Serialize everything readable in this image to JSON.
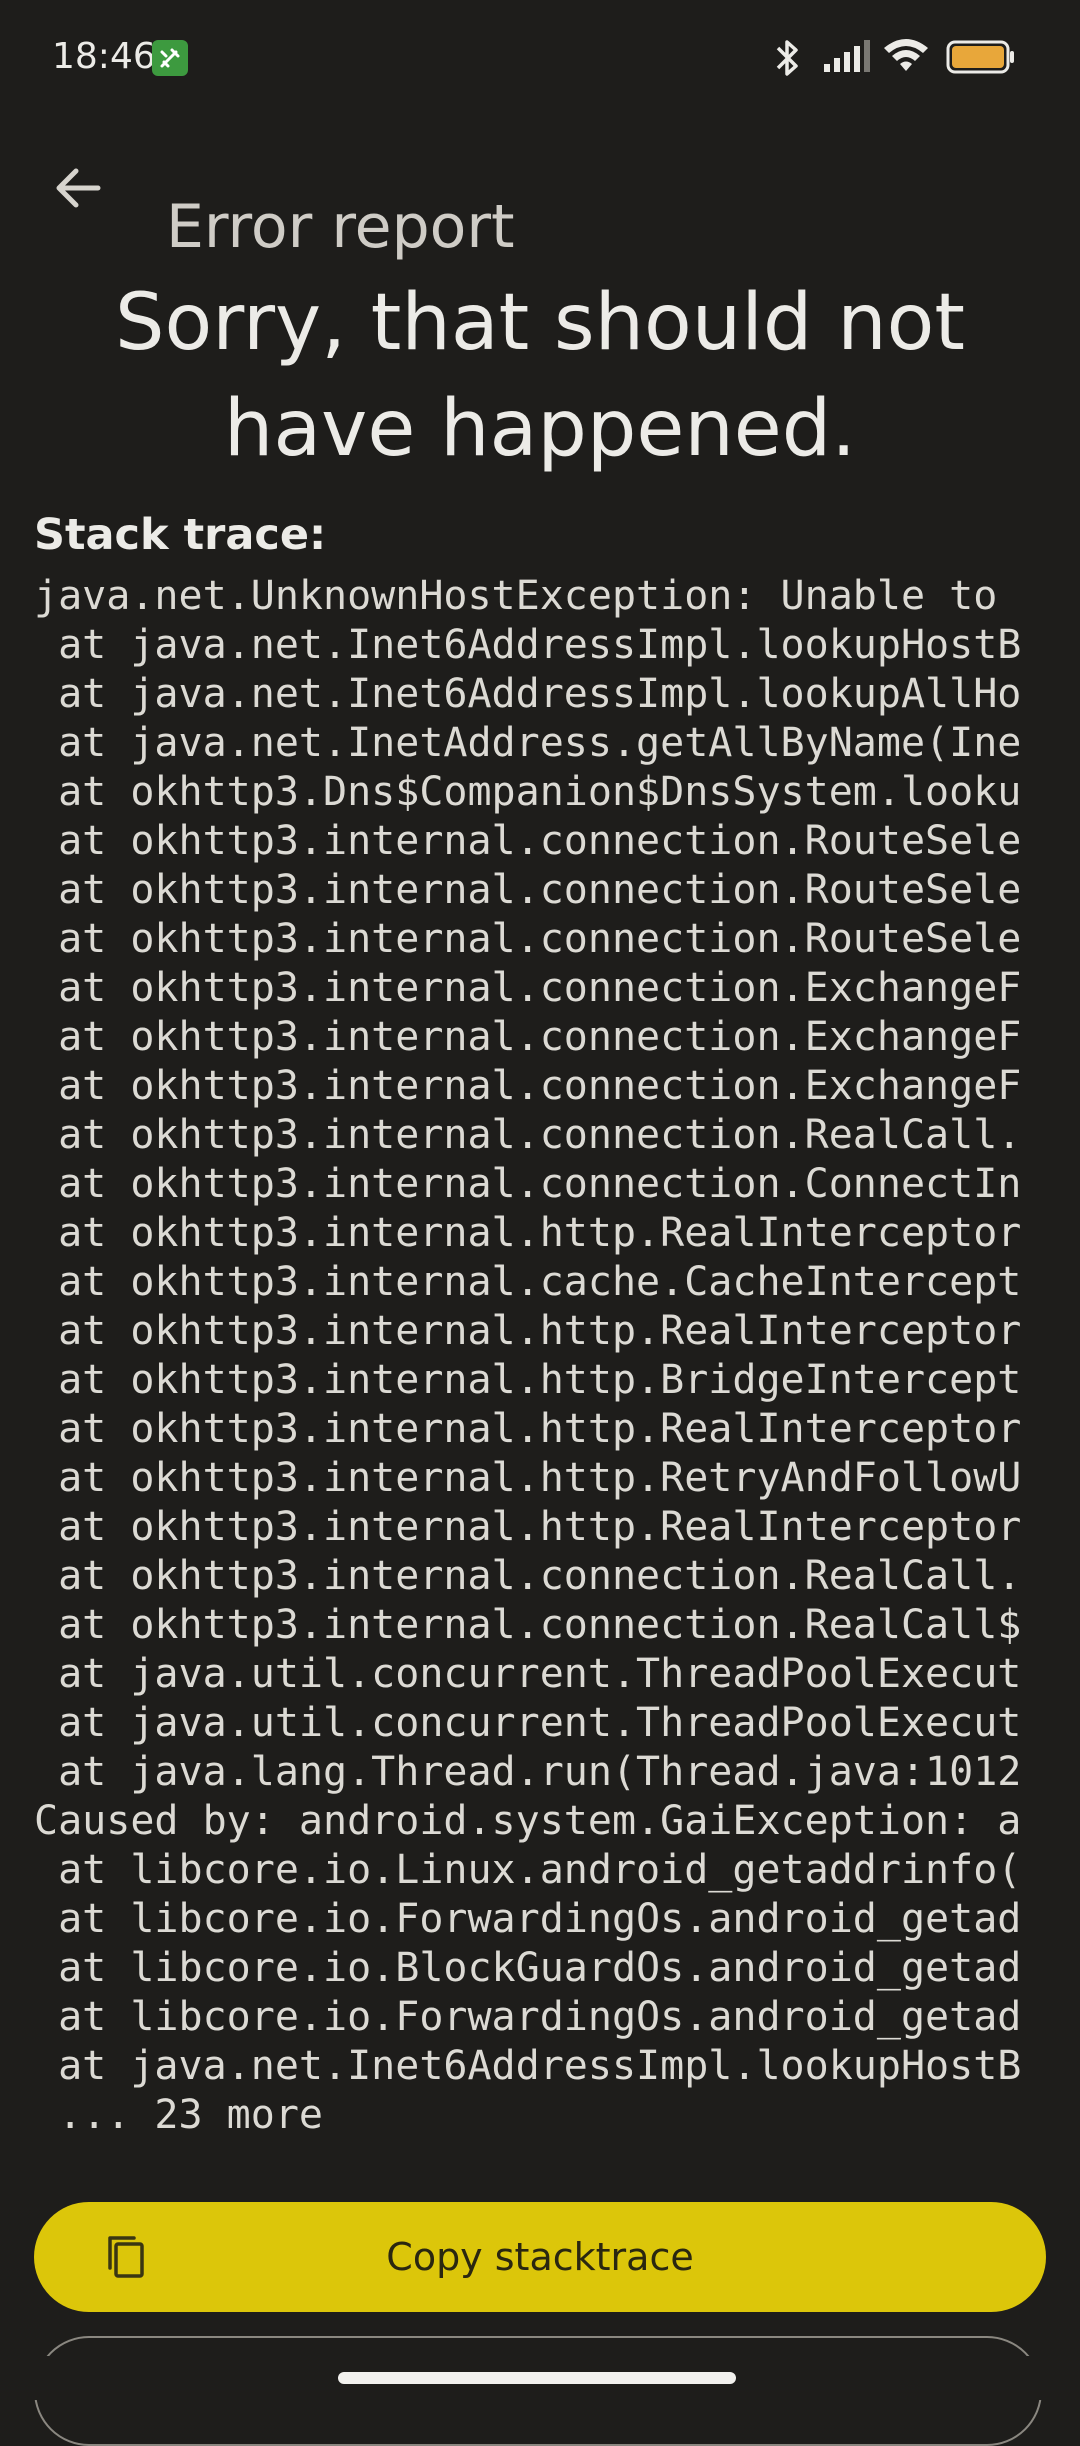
{
  "status_bar": {
    "time": "18:46",
    "icons": [
      "app-notification-icon",
      "bluetooth-icon",
      "signal-icon",
      "wifi-icon",
      "battery-icon"
    ],
    "battery_color": "#e8a73a"
  },
  "app_bar": {
    "title": "Error report",
    "back_icon": "arrow-left-icon"
  },
  "headline": "Sorry, that should not have happened.",
  "stack": {
    "label": "Stack trace:",
    "lines": [
      "java.net.UnknownHostException: Unable to",
      " at java.net.Inet6AddressImpl.lookupHostB",
      " at java.net.Inet6AddressImpl.lookupAllHo",
      " at java.net.InetAddress.getAllByName(Ine",
      " at okhttp3.Dns$Companion$DnsSystem.looku",
      " at okhttp3.internal.connection.RouteSele",
      " at okhttp3.internal.connection.RouteSele",
      " at okhttp3.internal.connection.RouteSele",
      " at okhttp3.internal.connection.ExchangeF",
      " at okhttp3.internal.connection.ExchangeF",
      " at okhttp3.internal.connection.ExchangeF",
      " at okhttp3.internal.connection.RealCall.",
      " at okhttp3.internal.connection.ConnectIn",
      " at okhttp3.internal.http.RealInterceptor",
      " at okhttp3.internal.cache.CacheIntercept",
      " at okhttp3.internal.http.RealInterceptor",
      " at okhttp3.internal.http.BridgeIntercept",
      " at okhttp3.internal.http.RealInterceptor",
      " at okhttp3.internal.http.RetryAndFollowU",
      " at okhttp3.internal.http.RealInterceptor",
      " at okhttp3.internal.connection.RealCall.",
      " at okhttp3.internal.connection.RealCall$",
      " at java.util.concurrent.ThreadPoolExecut",
      " at java.util.concurrent.ThreadPoolExecut",
      " at java.lang.Thread.run(Thread.java:1012",
      "Caused by: android.system.GaiException: a",
      " at libcore.io.Linux.android_getaddrinfo(",
      " at libcore.io.ForwardingOs.android_getad",
      " at libcore.io.BlockGuardOs.android_getad",
      " at libcore.io.ForwardingOs.android_getad",
      " at java.net.Inet6AddressImpl.lookupHostB",
      " ... 23 more"
    ]
  },
  "actions": {
    "copy_label": "Copy stacktrace",
    "copy_icon": "copy-icon",
    "accent_color": "#dcc60a"
  }
}
